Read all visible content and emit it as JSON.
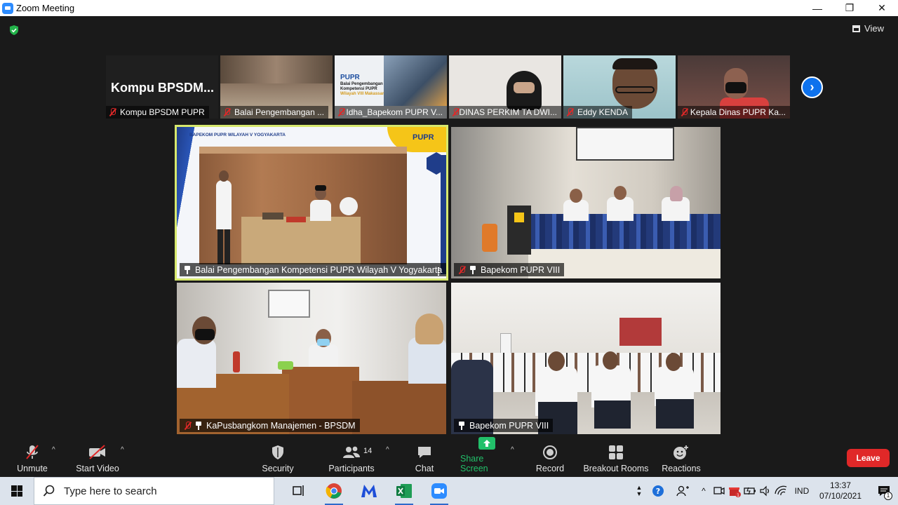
{
  "window": {
    "title": "Zoom Meeting",
    "controls": [
      "—",
      "❐",
      "✕"
    ]
  },
  "view_button": {
    "label": "View"
  },
  "thumbnails": [
    {
      "name": "Kompu BPSDM PUPR",
      "display_text": "Kompu  BPSDM..."
    },
    {
      "name": "Balai Pengembangan ..."
    },
    {
      "name": "Idha_Bapekom PUPR V...",
      "slide_brand": "PUPR",
      "slide_text": [
        "Balai Pengembangan",
        "Kompetensi PUPR",
        "Wilayah VIII Makassar"
      ]
    },
    {
      "name": "DINAS PERKIM TA DWI..."
    },
    {
      "name": "Eddy KENDA"
    },
    {
      "name": "Kepala Dinas PUPR Ka..."
    }
  ],
  "tiles": [
    {
      "name": "Balai Pengembangan Kompetensi PUPR Wilayah V Yogyakarta",
      "muted": false,
      "pinned": true,
      "header": "BAPEKOM PUPR WILAYAH V YOGYAKARTA",
      "brand": "PUPR"
    },
    {
      "name": "Bapekom PUPR VIII",
      "muted": true,
      "pinned": true
    },
    {
      "name": "KaPusbangkom Manajemen - BPSDM",
      "muted": true,
      "pinned": true
    },
    {
      "name": "Bapekom PUPR VIII",
      "muted": false,
      "pinned": true
    }
  ],
  "controls": {
    "unmute": "Unmute",
    "start_video": "Start Video",
    "security": "Security",
    "participants": "Participants",
    "participants_count": "14",
    "chat": "Chat",
    "share_screen": "Share Screen",
    "record": "Record",
    "breakout_rooms": "Breakout Rooms",
    "reactions": "Reactions",
    "leave": "Leave"
  },
  "taskbar": {
    "search_placeholder": "Type here to search",
    "apps": [
      "task-view",
      "chrome",
      "malwarebytes",
      "excel",
      "zoom"
    ],
    "language": "IND",
    "time": "13:37",
    "date": "07/10/2021",
    "notification_count": "1"
  },
  "colors": {
    "accent_blue": "#0e72ed",
    "leave_red": "#e02828",
    "share_green": "#22c06a",
    "active_speaker": "#d7e86d"
  }
}
